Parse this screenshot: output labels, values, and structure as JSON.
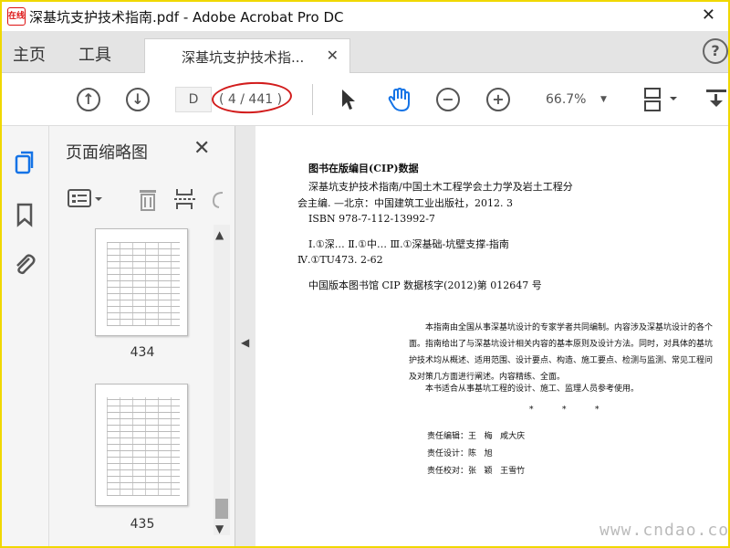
{
  "window": {
    "title": "深基坑支护技术指南.pdf - Adobe Acrobat Pro DC",
    "logo_text": "在线"
  },
  "tabs": {
    "home": "主页",
    "tools": "工具",
    "document": "深基坑支护技术指...",
    "help": "?"
  },
  "toolbar": {
    "page_input": "D",
    "page_count": "( 4 / 441 )",
    "zoom": "66.7%"
  },
  "thumbnails_panel": {
    "title": "页面缩略图",
    "pages": [
      {
        "label": "434"
      },
      {
        "label": "435"
      }
    ]
  },
  "document": {
    "cip_title": "图书在版编目(CIP)数据",
    "cip_line1": "深基坑支护技术指南/中国土木工程学会土力学及岩土工程分",
    "cip_line2": "会主编. —北京：中国建筑工业出版社，2012. 3",
    "cip_isbn": "ISBN 978-7-112-13992-7",
    "cip_subject1": "Ⅰ.①深…  Ⅱ.①中…  Ⅲ.①深基础-坑壁支撑-指南",
    "cip_subject2": "Ⅳ.①TU473. 2-62",
    "cip_number": "中国版本图书馆 CIP 数据核字(2012)第 012647 号",
    "summary_line1": "本指南由全国从事深基坑设计的专家学者共同编制。内容涉及深基坑设计的各个",
    "summary_line2": "面。指南给出了与深基坑设计相关内容的基本原则及设计方法。同时，对具体的基坑",
    "summary_line3": "护技术均从概述、适用范围、设计要点、构造、施工要点、检测与监测、常见工程问",
    "summary_line4": "及对策几方面进行阐述。内容精练、全面。",
    "summary_line5": "本书适合从事基坑工程的设计、施工、监理人员参考使用。",
    "stars": "*           *           *",
    "editor": "责任编辑：王   梅   咸大庆",
    "designer": "责任设计：陈   旭",
    "proofreader": "责任校对：张   颖   王雪竹"
  },
  "watermark": "www.cndao.com"
}
